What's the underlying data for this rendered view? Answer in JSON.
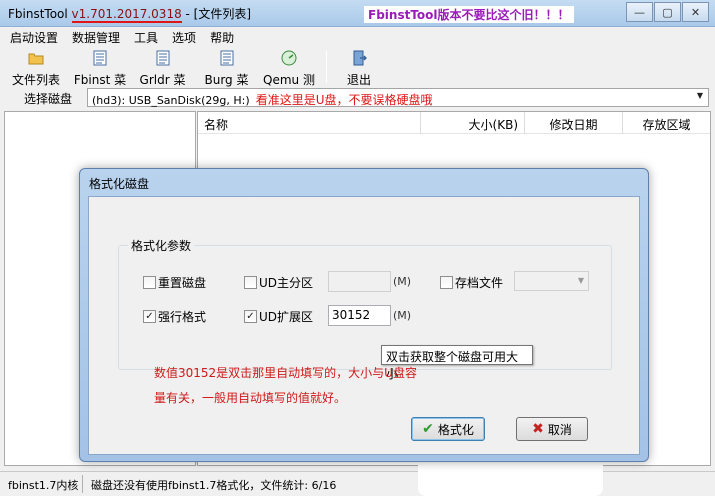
{
  "window": {
    "title_prefix": "FbinstTool ",
    "version": "v1.701.2017.0318",
    "title_suffix": " - [文件列表]",
    "annotation": "FbinstTool版本不要比这个旧！！！",
    "controls": [
      "—",
      "▢",
      "✕"
    ]
  },
  "menu": [
    "启动设置",
    "数据管理",
    "工具",
    "选项",
    "帮助"
  ],
  "toolbar": {
    "file_list": "文件列表",
    "fbinst_menu": "Fbinst 菜单",
    "grldr_menu": "Grldr 菜单",
    "burg_menu": "Burg 菜单",
    "qemu_test": "Qemu 测试",
    "exit": "退出"
  },
  "disk": {
    "label": "选择磁盘",
    "selected": "(hd3): USB_SanDisk(29g, H:)",
    "warning": "看准这里是U盘，不要误格硬盘哦"
  },
  "file_table": {
    "columns": [
      "名称",
      "大小(KB)",
      "修改日期",
      "存放区域"
    ]
  },
  "dialog": {
    "title": "格式化磁盘",
    "group_label": "格式化参数",
    "reset_disk": "重置磁盘",
    "ud_primary": "UD主分区",
    "archive_file": "存档文件",
    "force_format": "强行格式",
    "ud_extended": "UD扩展区",
    "unit": "(M)",
    "ud_extended_value": "30152",
    "tooltip": "双击获取整个磁盘可用大小",
    "annotation_line1": "数值30152是双击那里自动填写的，大小与U盘容",
    "annotation_line2": "量有关，一般用自动填写的值就好。",
    "format_button": "格式化",
    "cancel_button": "取消",
    "checked_mark": "✓"
  },
  "status": {
    "kernel": "fbinst1.7内核",
    "message": "磁盘还没有使用fbinst1.7格式化，文件统计: 6/16"
  }
}
